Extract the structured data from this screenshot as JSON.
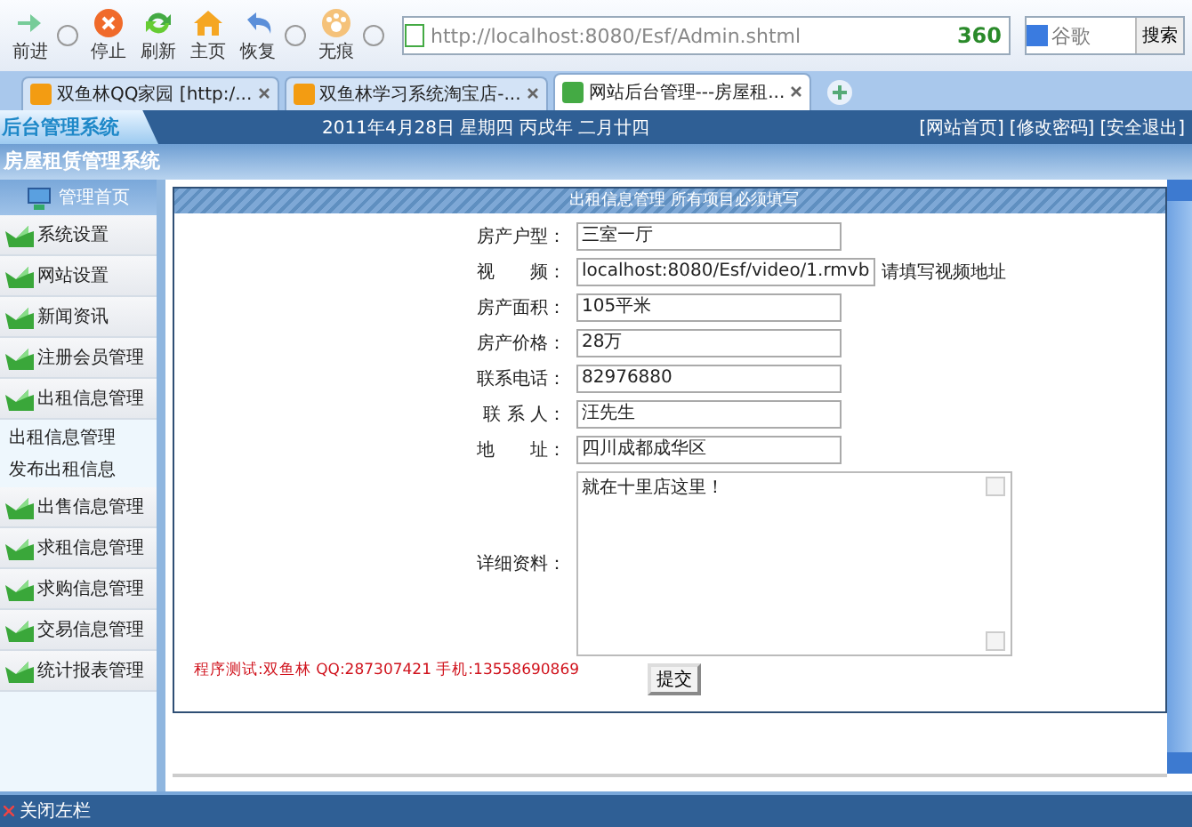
{
  "browser": {
    "nav_buttons": [
      {
        "label": "前进"
      },
      {
        "label": "停止"
      },
      {
        "label": "刷新"
      },
      {
        "label": "主页"
      },
      {
        "label": "恢复"
      },
      {
        "label": "无痕"
      }
    ],
    "address": "http://localhost:8080/Esf/Admin.shtml",
    "security_badge": "360",
    "search": {
      "placeholder": "谷歌",
      "button": "搜索"
    },
    "tabs": [
      {
        "label": "双鱼林QQ家园 [http:/...",
        "selected": false
      },
      {
        "label": "双鱼林学习系统淘宝店-...",
        "selected": false
      },
      {
        "label": "网站后台管理---房屋租...",
        "selected": true
      }
    ]
  },
  "header": {
    "logo": "后台管理系统",
    "date": "2011年4月28日 星期四 丙戌年 二月廿四",
    "links": [
      "[网站首页]",
      "[修改密码]",
      "[安全退出]"
    ],
    "subtitle": "房屋租赁管理系统"
  },
  "sidebar": {
    "title": "管理首页",
    "items": [
      {
        "label": "系统设置"
      },
      {
        "label": "网站设置"
      },
      {
        "label": "新闻资讯"
      },
      {
        "label": "注册会员管理"
      },
      {
        "label": "出租信息管理",
        "children": [
          {
            "label": "出租信息管理"
          },
          {
            "label": "发布出租信息"
          }
        ]
      },
      {
        "label": "出售信息管理"
      },
      {
        "label": "求租信息管理"
      },
      {
        "label": "求购信息管理"
      },
      {
        "label": "交易信息管理"
      },
      {
        "label": "统计报表管理"
      }
    ]
  },
  "form": {
    "title": "出租信息管理  所有项目必须填写",
    "fields": [
      {
        "label": "房产户型：",
        "value": "三室一厅"
      },
      {
        "label": "视　　频：",
        "value": "localhost:8080/Esf/video/1.rmvb",
        "hint": "请填写视频地址"
      },
      {
        "label": "房产面积：",
        "value": "105平米"
      },
      {
        "label": "房产价格：",
        "value": "28万"
      },
      {
        "label": "联系电话：",
        "value": "82976880"
      },
      {
        "label": "联 系 人：",
        "value": "汪先生"
      },
      {
        "label": "地　　址：",
        "value": "四川成都成华区"
      }
    ],
    "details": {
      "label": "详细资料：",
      "value": "就在十里店这里！"
    },
    "credit": "程序测试:双鱼林 QQ:287307421 手机:13558690869",
    "submit": "提交"
  },
  "status_bar": {
    "toggle": "关闭左栏"
  }
}
